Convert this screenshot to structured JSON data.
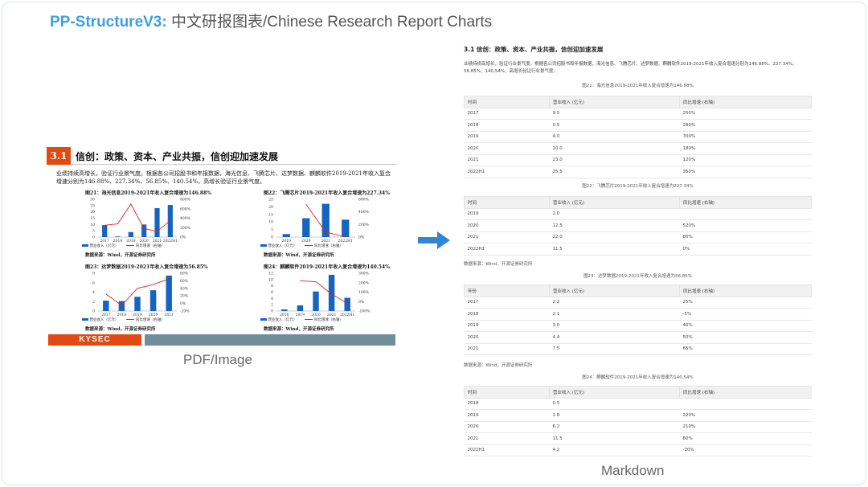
{
  "header": {
    "brand": "PP-StructureV3:",
    "subtitle": " 中文研报图表/Chinese Research Report Charts"
  },
  "left": {
    "label": "PDF/Image",
    "section_number": "3.1",
    "section_title": "信创：政策、资本、产业共振，信创迎加速发展",
    "paragraph": "业绩持续高增长，验证行业景气度。根据各公司招股书和年报数据，海光信息、飞腾芯片、达梦数据、麒麟软件2019-2021年收入复合增速分别为146.88%、227.34%、56.85%、140.54%，高增长验证行业景气度。",
    "footer_logo": "KYSEC",
    "figures": [
      {
        "title": "图21：海光信息2019-2021年收入复合增速为146.88%",
        "legend_bar": "营业收入（亿元）",
        "legend_line": "同比增速（右轴）",
        "source": "数据来源：Wind，开源证券研究所",
        "categories": [
          "2017",
          "2018",
          "2019",
          "2020",
          "2021",
          "2022H1"
        ],
        "bars": [
          9.5,
          0.5,
          4.0,
          10.0,
          23.0,
          25.5
        ],
        "line": [
          250,
          280,
          700,
          180,
          120,
          350
        ],
        "y_ticks": [
          "30",
          "25",
          "20",
          "15",
          "10",
          "5",
          "0"
        ],
        "y2_ticks": [
          "800%",
          "600%",
          "400%",
          "200%",
          "0%"
        ],
        "ymax": 30,
        "y2max": 800
      },
      {
        "title": "图22：飞腾芯片2019-2021年收入复合增速为227.34%",
        "legend_bar": "营业收入（亿元）",
        "legend_line": "同比增速（右轴）",
        "source": "数据来源：Wind，开源证券研究所",
        "categories": [
          "2019",
          "2020",
          "2021",
          "2022H1"
        ],
        "bars": [
          2.0,
          12.5,
          22.0,
          11.5
        ],
        "line": [
          null,
          520,
          80,
          0
        ],
        "y_ticks": [
          "25",
          "20",
          "15",
          "10",
          "5",
          "0"
        ],
        "y2_ticks": [
          "600%",
          "400%",
          "200%",
          "0%"
        ],
        "ymax": 25,
        "y2max": 600
      },
      {
        "title": "图23：达梦数据2019-2021年收入复合增速为56.85%",
        "legend_bar": "营业收入（亿元）",
        "legend_line": "同比增速（右轴）",
        "source": "数据来源：Wind，开源证券研究所",
        "categories": [
          "2017",
          "2018",
          "2019",
          "2020",
          "2021"
        ],
        "bars": [
          2.2,
          2.1,
          3.0,
          4.4,
          7.5
        ],
        "line": [
          25,
          -5,
          40,
          50,
          65
        ],
        "y_ticks": [
          "8",
          "6",
          "4",
          "2",
          "0"
        ],
        "y2_ticks": [
          "80%",
          "60%",
          "40%",
          "20%",
          "0%",
          "-20%"
        ],
        "ymax": 8,
        "y2min": -20,
        "y2max": 80
      },
      {
        "title": "图24：麒麟软件2019-2021年收入复合增速为140.54%",
        "legend_bar": "营业收入（亿元）",
        "legend_line": "同比增速（右轴）",
        "source": "数据来源：Wind，开源证券研究所",
        "categories": [
          "2018",
          "2019",
          "2020",
          "2021",
          "2022H1"
        ],
        "bars": [
          0.5,
          1.8,
          6.2,
          11.5,
          4.2
        ],
        "line": [
          null,
          220,
          210,
          80,
          -20
        ],
        "y_ticks": [
          "12",
          "10",
          "8",
          "6",
          "4",
          "2",
          "0"
        ],
        "y2_ticks": [
          "300%",
          "200%",
          "100%",
          "0%",
          "-100%"
        ],
        "ymax": 12,
        "y2min": -100,
        "y2max": 300
      }
    ]
  },
  "right": {
    "label": "Markdown",
    "heading": "3.1 信创：政策、资本、产业共振，信创迎加速发展",
    "paragraph": "业绩持续高增长，验证行业景气度。根据各公司招股书和年报数据，海光信息、飞腾芯片、达梦数据、麒麟软件2019-2021年收入复合增速分别为146.88%、227.34%、56.85%、140.54%，高增长验证行业景气度。",
    "caption1": "图21：海光信息2019-2021年收入复合增速为146.88%",
    "caption2": "图22：飞腾芯片2019-2021年收入复合增速为227.34%",
    "caption3": "图23：达梦数据2019-2021年收入复合增速为56.85%",
    "caption4": "图24：麒麟软件2019-2021年收入复合增速为140.54%",
    "source": "数据来源：Wind，开源证券研究所",
    "tables": [
      {
        "headers": [
          "时间",
          "营业收入 (亿元)",
          "同比增速 (右轴)"
        ],
        "rows": [
          [
            "2017",
            "9.5",
            "250%"
          ],
          [
            "2018",
            "0.5",
            "280%"
          ],
          [
            "2019",
            "4.0",
            "700%"
          ],
          [
            "2020",
            "10.0",
            "180%"
          ],
          [
            "2021",
            "23.0",
            "120%"
          ],
          [
            "2022H1",
            "25.5",
            "350%"
          ]
        ]
      },
      {
        "headers": [
          "时间",
          "营业收入 (亿元)",
          "同比增速 (右轴)"
        ],
        "rows": [
          [
            "2019",
            "2.0",
            ""
          ],
          [
            "2020",
            "12.5",
            "520%"
          ],
          [
            "2021",
            "22.0",
            "80%"
          ],
          [
            "2022H1",
            "11.5",
            "0%"
          ]
        ]
      },
      {
        "headers": [
          "年份",
          "营业收入 (亿元)",
          "同比增速 (右轴)"
        ],
        "rows": [
          [
            "2017",
            "2.2",
            "25%"
          ],
          [
            "2018",
            "2.1",
            "-5%"
          ],
          [
            "2019",
            "3.0",
            "40%"
          ],
          [
            "2020",
            "4.4",
            "50%"
          ],
          [
            "2021",
            "7.5",
            "65%"
          ]
        ]
      },
      {
        "headers": [
          "时间",
          "营业收入 (亿元)",
          "同比增速 (右轴)"
        ],
        "rows": [
          [
            "2018",
            "0.5",
            ""
          ],
          [
            "2019",
            "1.8",
            "220%"
          ],
          [
            "2020",
            "6.2",
            "210%"
          ],
          [
            "2021",
            "11.5",
            "80%"
          ],
          [
            "2022H1",
            "4.2",
            "-20%"
          ]
        ]
      }
    ]
  },
  "colors": {
    "brand": "#3aa0e8",
    "accent_red": "#e24a12",
    "bar": "#1565c0",
    "line": "#e02020",
    "arrow": "#2f86d6"
  }
}
